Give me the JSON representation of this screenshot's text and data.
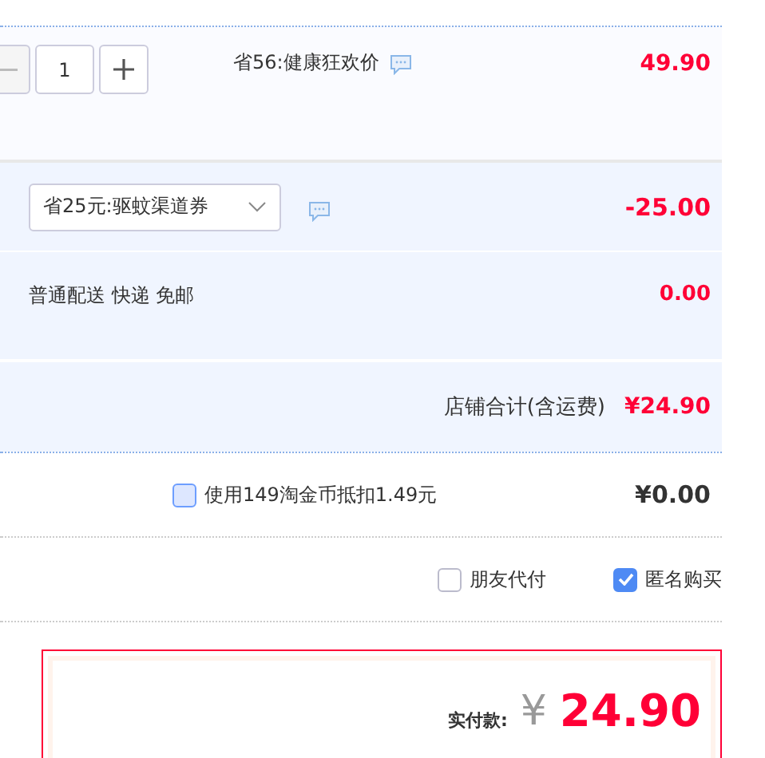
{
  "item": {
    "quantity": "1",
    "promo": "省56:健康狂欢价",
    "price": "49.90"
  },
  "coupon": {
    "selected_value": "省25元:驱蚊渠道券",
    "amount": "-25.00"
  },
  "shipping": {
    "label": "普通配送 快递 免邮",
    "amount": "0.00"
  },
  "shop_total": {
    "label": "店铺合计(含运费)",
    "amount": "¥24.90"
  },
  "coins": {
    "label": "使用149淘金币抵扣1.49元",
    "checked": false,
    "amount": "¥0.00"
  },
  "options": [
    {
      "label": "朋友代付",
      "checked": false
    },
    {
      "label": "匿名购买",
      "checked": true
    }
  ],
  "payment": {
    "label": "实付款:",
    "currency": "¥",
    "amount": "24.90"
  }
}
